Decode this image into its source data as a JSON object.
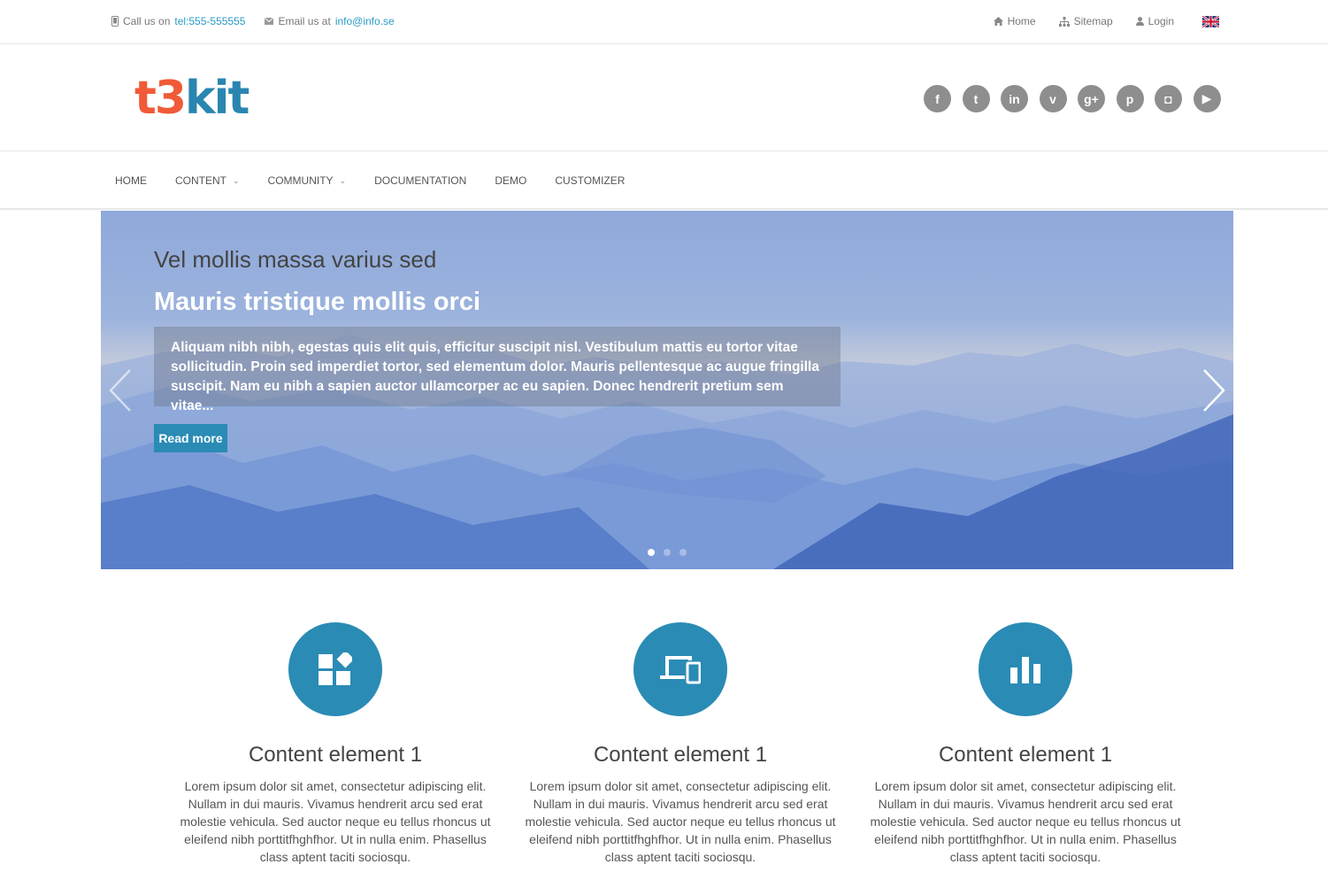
{
  "topbar": {
    "call_label": "Call us on",
    "phone": "tel:555-555555",
    "email_label": "Email us at",
    "email": "info@info.se",
    "links": [
      {
        "label": "Home",
        "icon": "home-icon"
      },
      {
        "label": "Sitemap",
        "icon": "sitemap-icon"
      },
      {
        "label": "Login",
        "icon": "user-icon"
      }
    ],
    "language_icon": "uk-flag-icon"
  },
  "header": {
    "logo_part1": "t3",
    "logo_part2": "kit",
    "logo_colors": {
      "t3": "#f05a37",
      "kit": "#2a86b0"
    },
    "social_icons": [
      "facebook-icon",
      "twitter-icon",
      "linkedin-icon",
      "vimeo-icon",
      "googleplus-icon",
      "pinterest-icon",
      "instagram-icon",
      "youtube-icon"
    ],
    "social_glyphs": [
      "f",
      "t",
      "in",
      "v",
      "g+",
      "p",
      "◘",
      "▶"
    ]
  },
  "nav": {
    "items": [
      {
        "label": "HOME",
        "dropdown": false
      },
      {
        "label": "CONTENT",
        "dropdown": true
      },
      {
        "label": "COMMUNITY",
        "dropdown": true
      },
      {
        "label": "DOCUMENTATION",
        "dropdown": false
      },
      {
        "label": "DEMO",
        "dropdown": false
      },
      {
        "label": "CUSTOMIZER",
        "dropdown": false
      }
    ]
  },
  "slider": {
    "subtitle": "Vel mollis massa varius sed",
    "title": "Mauris tristique mollis orci",
    "text": "Aliquam nibh nibh, egestas quis elit quis, efficitur suscipit nisl. Vestibulum mattis eu tortor vitae sollicitudin. Proin sed imperdiet tortor, sed elementum dolor. Mauris pellentesque ac augue fringilla suscipit. Nam eu nibh a sapien auctor ullamcorper ac eu sapien. Donec hendrerit pretium sem vitae...",
    "button": "Read more",
    "slide_count": 3,
    "active_slide": 1
  },
  "features": [
    {
      "icon": "widgets-icon",
      "title": "Content element 1",
      "text": "Lorem ipsum dolor sit amet, consectetur adipiscing elit. Nullam in dui mauris. Vivamus hendrerit arcu sed erat molestie vehicula. Sed auctor neque eu tellus rhoncus ut eleifend nibh porttitfhghfhor. Ut in nulla enim. Phasellus class aptent taciti sociosqu."
    },
    {
      "icon": "devices-icon",
      "title": "Content element 1",
      "text": "Lorem ipsum dolor sit amet, consectetur adipiscing elit. Nullam in dui mauris. Vivamus hendrerit arcu sed erat molestie vehicula. Sed auctor neque eu tellus rhoncus ut eleifend nibh porttitfhghfhor. Ut in nulla enim. Phasellus class aptent taciti sociosqu."
    },
    {
      "icon": "bar-chart-icon",
      "title": "Content element 1",
      "text": "Lorem ipsum dolor sit amet, consectetur adipiscing elit. Nullam in dui mauris. Vivamus hendrerit arcu sed erat molestie vehicula. Sed auctor neque eu tellus rhoncus ut eleifend nibh porttitfhghfhor. Ut in nulla enim. Phasellus class aptent taciti sociosqu."
    }
  ],
  "colors": {
    "accent": "#2a8bb5",
    "link": "#2a9bc4",
    "social_gray": "#8e8e8e"
  }
}
